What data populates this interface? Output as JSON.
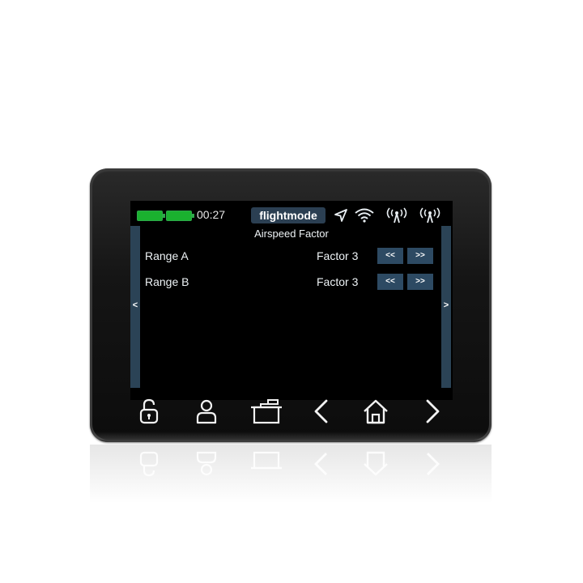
{
  "status_bar": {
    "time": "00:27",
    "flightmode": "flightmode",
    "icons": [
      "battery-icon",
      "battery-icon",
      "gps-arrow-icon",
      "wifi-icon",
      "antenna-signal-icon",
      "antenna-signal-icon"
    ]
  },
  "screen": {
    "title": "Airspeed Factor",
    "left_nav": "<",
    "right_nav": ">",
    "rows": [
      {
        "label": "Range A",
        "factor": "Factor 3",
        "decrement": "<<",
        "increment": ">>"
      },
      {
        "label": "Range B",
        "factor": "Factor 3",
        "decrement": "<<",
        "increment": ">>"
      }
    ]
  },
  "hardware_buttons": [
    {
      "icon": "unlock-icon"
    },
    {
      "icon": "user-icon"
    },
    {
      "icon": "model-icon"
    },
    {
      "icon": "chevron-left-icon"
    },
    {
      "icon": "home-icon"
    },
    {
      "icon": "chevron-right-icon"
    }
  ],
  "colors": {
    "screen_bg": "#000000",
    "accent": "#2b4356",
    "button": "#2d4a63",
    "battery": "#1ab12f"
  }
}
